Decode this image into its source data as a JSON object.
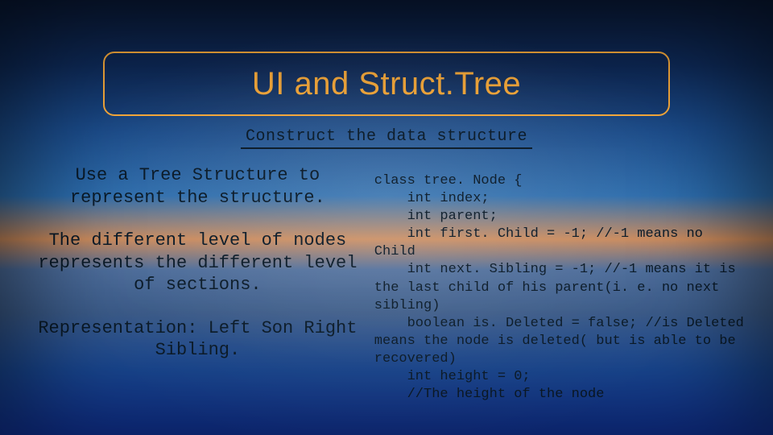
{
  "title": "UI and Struct.Tree",
  "subtitle": "Construct the data structure",
  "left": {
    "p1": "Use a Tree Structure to represent the structure.",
    "p2": "The different level of nodes represents the different level of sections.",
    "p3": "Representation:  Left Son Right Sibling."
  },
  "code": "class tree. Node {\n    int index;\n    int parent;\n    int first. Child = -1; //-1 means no Child\n    int next. Sibling = -1; //-1 means it is the last child of his parent(i. e. no next sibling)\n    boolean is. Deleted = false; //is Deleted means the node is deleted( but is able to be recovered)\n    int height = 0;\n    //The height of the node"
}
